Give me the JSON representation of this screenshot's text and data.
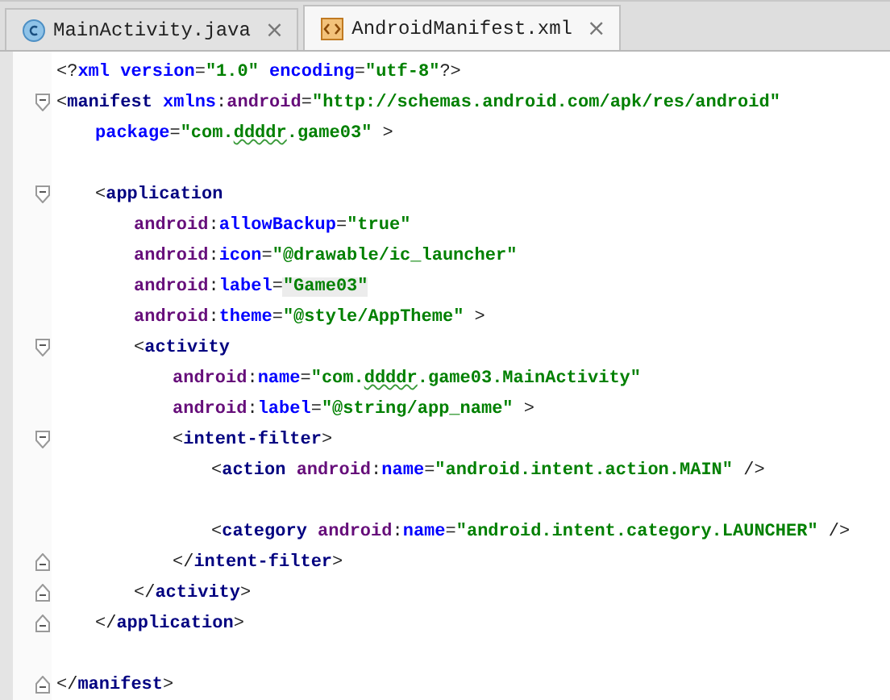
{
  "tabs": [
    {
      "label": "MainActivity.java",
      "kind": "class",
      "selected": false,
      "close": "×"
    },
    {
      "label": "AndroidManifest.xml",
      "kind": "xml",
      "selected": true,
      "close": "×"
    }
  ],
  "editor": {
    "lines": [
      {
        "kind": "plain",
        "tokens": [
          {
            "kind": "punct",
            "text": "<?"
          },
          {
            "kind": "attr",
            "text": "xml version"
          },
          {
            "kind": "punct",
            "text": "="
          },
          {
            "kind": "value",
            "text": "\"1.0\""
          },
          {
            "kind": "attr",
            "text": " encoding"
          },
          {
            "kind": "punct",
            "text": "="
          },
          {
            "kind": "value",
            "text": "\"utf-8\""
          },
          {
            "kind": "punct",
            "text": "?>"
          }
        ]
      },
      {
        "kind": "fold-start",
        "tokens": [
          {
            "kind": "punct",
            "text": "<"
          },
          {
            "kind": "tag",
            "text": "manifest "
          },
          {
            "kind": "attr",
            "text": "xmlns"
          },
          {
            "kind": "punct",
            "text": ":"
          },
          {
            "kind": "ns",
            "text": "android"
          },
          {
            "kind": "punct",
            "text": "="
          },
          {
            "kind": "value",
            "text": "\"http://schemas.android.com/apk/res/android\""
          }
        ],
        "children": [
          {
            "kind": "plain",
            "tokens": [
              {
                "kind": "attr",
                "text": "package"
              },
              {
                "kind": "punct",
                "text": "="
              },
              {
                "kind": "value",
                "text": "\"com."
              },
              {
                "kind": "value",
                "text": "ddddr",
                "typo": true
              },
              {
                "kind": "value",
                "text": ".game03\""
              },
              {
                "kind": "punct",
                "text": " >"
              }
            ]
          },
          {
            "kind": "blank"
          },
          {
            "kind": "fold-start",
            "tokens": [
              {
                "kind": "punct",
                "text": "<"
              },
              {
                "kind": "tag",
                "text": "application"
              }
            ],
            "children": [
              {
                "kind": "plain",
                "tokens": [
                  {
                    "kind": "ns",
                    "text": "android"
                  },
                  {
                    "kind": "punct",
                    "text": ":"
                  },
                  {
                    "kind": "attr",
                    "text": "allowBackup"
                  },
                  {
                    "kind": "punct",
                    "text": "="
                  },
                  {
                    "kind": "value",
                    "text": "\"true\""
                  }
                ]
              },
              {
                "kind": "plain",
                "tokens": [
                  {
                    "kind": "ns",
                    "text": "android"
                  },
                  {
                    "kind": "punct",
                    "text": ":"
                  },
                  {
                    "kind": "attr",
                    "text": "icon"
                  },
                  {
                    "kind": "punct",
                    "text": "="
                  },
                  {
                    "kind": "value",
                    "text": "\"@drawable/ic_launcher\""
                  }
                ]
              },
              {
                "kind": "plain",
                "tokens": [
                  {
                    "kind": "ns",
                    "text": "android"
                  },
                  {
                    "kind": "punct",
                    "text": ":"
                  },
                  {
                    "kind": "attr",
                    "text": "label"
                  },
                  {
                    "kind": "punct",
                    "text": "="
                  },
                  {
                    "kind": "literal",
                    "text": "\"Game03\""
                  }
                ]
              },
              {
                "kind": "plain",
                "tokens": [
                  {
                    "kind": "ns",
                    "text": "android"
                  },
                  {
                    "kind": "punct",
                    "text": ":"
                  },
                  {
                    "kind": "attr",
                    "text": "theme"
                  },
                  {
                    "kind": "punct",
                    "text": "="
                  },
                  {
                    "kind": "value",
                    "text": "\"@style/AppTheme\""
                  },
                  {
                    "kind": "punct",
                    "text": " >"
                  }
                ]
              },
              {
                "kind": "fold-start",
                "tokens": [
                  {
                    "kind": "punct",
                    "text": "<"
                  },
                  {
                    "kind": "tag",
                    "text": "activity"
                  }
                ],
                "children": [
                  {
                    "kind": "plain",
                    "tokens": [
                      {
                        "kind": "ns",
                        "text": "android"
                      },
                      {
                        "kind": "punct",
                        "text": ":"
                      },
                      {
                        "kind": "attr",
                        "text": "name"
                      },
                      {
                        "kind": "punct",
                        "text": "="
                      },
                      {
                        "kind": "value",
                        "text": "\"com."
                      },
                      {
                        "kind": "value",
                        "text": "ddddr",
                        "typo": true
                      },
                      {
                        "kind": "value",
                        "text": ".game03.MainActivity\""
                      }
                    ]
                  },
                  {
                    "kind": "plain",
                    "tokens": [
                      {
                        "kind": "ns",
                        "text": "android"
                      },
                      {
                        "kind": "punct",
                        "text": ":"
                      },
                      {
                        "kind": "attr",
                        "text": "label"
                      },
                      {
                        "kind": "punct",
                        "text": "="
                      },
                      {
                        "kind": "value",
                        "text": "\"@string/app_name\""
                      },
                      {
                        "kind": "punct",
                        "text": " >"
                      }
                    ]
                  },
                  {
                    "kind": "fold-start",
                    "tokens": [
                      {
                        "kind": "punct",
                        "text": "<"
                      },
                      {
                        "kind": "tag",
                        "text": "intent-filter"
                      },
                      {
                        "kind": "punct",
                        "text": ">"
                      }
                    ],
                    "children": [
                      {
                        "kind": "plain",
                        "tokens": [
                          {
                            "kind": "punct",
                            "text": "<"
                          },
                          {
                            "kind": "tag",
                            "text": "action "
                          },
                          {
                            "kind": "ns",
                            "text": "android"
                          },
                          {
                            "kind": "punct",
                            "text": ":"
                          },
                          {
                            "kind": "attr",
                            "text": "name"
                          },
                          {
                            "kind": "punct",
                            "text": "="
                          },
                          {
                            "kind": "value",
                            "text": "\"android.intent.action.MAIN\""
                          },
                          {
                            "kind": "punct",
                            "text": " />"
                          }
                        ]
                      },
                      {
                        "kind": "blank"
                      },
                      {
                        "kind": "plain",
                        "tokens": [
                          {
                            "kind": "punct",
                            "text": "<"
                          },
                          {
                            "kind": "tag",
                            "text": "category "
                          },
                          {
                            "kind": "ns",
                            "text": "android"
                          },
                          {
                            "kind": "punct",
                            "text": ":"
                          },
                          {
                            "kind": "attr",
                            "text": "name"
                          },
                          {
                            "kind": "punct",
                            "text": "="
                          },
                          {
                            "kind": "value",
                            "text": "\"android.intent.category.LAUNCHER\""
                          },
                          {
                            "kind": "punct",
                            "text": " />"
                          }
                        ]
                      }
                    ]
                  },
                  {
                    "kind": "fold-end",
                    "tokens": [
                      {
                        "kind": "punct",
                        "text": "</"
                      },
                      {
                        "kind": "tag",
                        "text": "intent-filter"
                      },
                      {
                        "kind": "punct",
                        "text": ">"
                      }
                    ]
                  }
                ]
              },
              {
                "kind": "fold-end",
                "tokens": [
                  {
                    "kind": "punct",
                    "text": "</"
                  },
                  {
                    "kind": "tag",
                    "text": "activity"
                  },
                  {
                    "kind": "punct",
                    "text": ">"
                  }
                ]
              }
            ]
          },
          {
            "kind": "fold-end",
            "tokens": [
              {
                "kind": "punct",
                "text": "</"
              },
              {
                "kind": "tag",
                "text": "application"
              },
              {
                "kind": "punct",
                "text": ">"
              }
            ]
          },
          {
            "kind": "blank"
          }
        ]
      },
      {
        "kind": "fold-end",
        "tokens": [
          {
            "kind": "punct",
            "text": "</"
          },
          {
            "kind": "tag",
            "text": "manifest"
          },
          {
            "kind": "punct",
            "text": ">"
          }
        ]
      }
    ]
  }
}
